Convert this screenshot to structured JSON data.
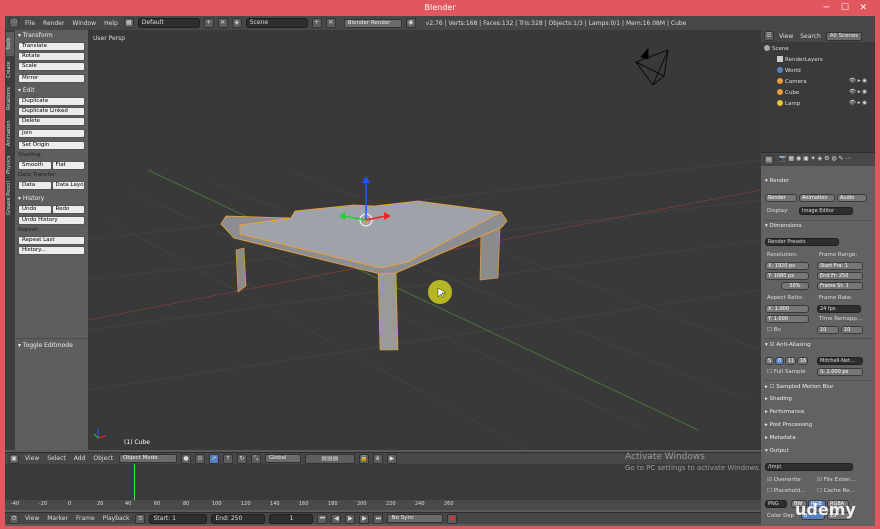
{
  "window": {
    "title": "Blender"
  },
  "menubar": {
    "items": [
      "File",
      "Render",
      "Window",
      "Help"
    ],
    "layout": "Default",
    "scene": "Scene",
    "engine": "Blender Render",
    "stats": "v2.76 | Verts:168 | Faces:132 | Tris:328 | Objects:1/3 | Lamps:0/1 | Mem:16.08M | Cube"
  },
  "tabs": [
    "Tools",
    "Create",
    "Relations",
    "Animation",
    "Physics",
    "Grease Pencil"
  ],
  "tools": {
    "transform": "Transform",
    "translate": "Translate",
    "rotate": "Rotate",
    "scale": "Scale",
    "mirror": "Mirror",
    "edit": "Edit",
    "duplicate": "Duplicate",
    "duplicate_linked": "Duplicate Linked",
    "delete": "Delete",
    "join": "Join",
    "set_origin": "Set Origin",
    "shading": "Shading:",
    "smooth": "Smooth",
    "flat": "Flat",
    "data_transfer": "Data Transfer:",
    "data": "Data",
    "data_layo": "Data Layo",
    "history": "History",
    "undo": "Undo",
    "redo": "Redo",
    "undo_history": "Undo History",
    "repeat": "Repeat:",
    "repeat_last": "Repeat Last",
    "history_btn": "History..."
  },
  "operator": {
    "title": "Toggle Editmode"
  },
  "viewport": {
    "label": "User Persp",
    "object": "(1) Cube"
  },
  "view3d_header": {
    "menus": [
      "View",
      "Select",
      "Add",
      "Object"
    ],
    "mode": "Object Mode",
    "orientation": "Global"
  },
  "timeline": {
    "menus": [
      "View",
      "Marker",
      "Frame",
      "Playback"
    ],
    "start": "Start:",
    "start_val": "1",
    "end": "End:",
    "end_val": "250",
    "frame": "1",
    "sync": "No Sync",
    "ruler": [
      "-40",
      "-20",
      "0",
      "20",
      "40",
      "60",
      "80",
      "100",
      "120",
      "140",
      "160",
      "180",
      "200",
      "220",
      "240",
      "260"
    ]
  },
  "watermark": {
    "line1": "Activate Windows",
    "line2": "Go to PC settings to activate Windows.",
    "brand": "udemy"
  },
  "outliner": {
    "tabs": [
      "View",
      "Search",
      "All Scenes"
    ],
    "items": [
      "Scene",
      "RenderLayers",
      "World",
      "Camera",
      "Cube",
      "Lamp"
    ]
  },
  "properties": {
    "render_panel": "Render",
    "render_btn": "Render",
    "anim_btn": "Animation",
    "audio_btn": "Audio",
    "display_label": "Display:",
    "display_val": "Image Editor",
    "dimensions": "Dimensions",
    "presets": "Render Presets",
    "resolution": "Resolution:",
    "res_x": "X: 1920 px",
    "res_y": "Y: 1080 px",
    "res_pct": "50%",
    "frame_range": "Frame Range:",
    "start_fr": "Start Fra: 1",
    "end_fr": "End Fr: 250",
    "frame_st": "Frame St: 1",
    "aspect": "Aspect Ratio:",
    "asp_x": "X: 1.000",
    "asp_y": "Y: 1.000",
    "frame_rate": "Frame Rate:",
    "fps": "24 fps",
    "time_remap": "Time Remapp...",
    "remap_a": "10",
    "remap_b": "10",
    "bo": "Bo",
    "aa": "Anti-Aliasing",
    "aa_levels": [
      "5",
      "8",
      "11",
      "16"
    ],
    "filter": "Mitchell-Net...",
    "full_sample": "Full Sample",
    "filter_size": "S: 1.000 px",
    "sampled_mb": "Sampled Motion Blur",
    "shading": "Shading",
    "performance": "Performance",
    "post": "Post Processing",
    "metadata": "Metadata",
    "output": "Output",
    "path": "/tmp\\",
    "overwrite": "Overwrite",
    "file_ext": "File Exten...",
    "placeholders": "Placehold...",
    "cache": "Cache Re...",
    "png": "PNG",
    "bw": "BW",
    "rgb": "RGB",
    "rgba": "RGBA",
    "color_depth": "Color Dep",
    "depth_a": "8",
    "depth_b": "16"
  },
  "colors": {
    "accent": "#5680c2",
    "title": "#e0575f",
    "select": "#f5a623"
  }
}
